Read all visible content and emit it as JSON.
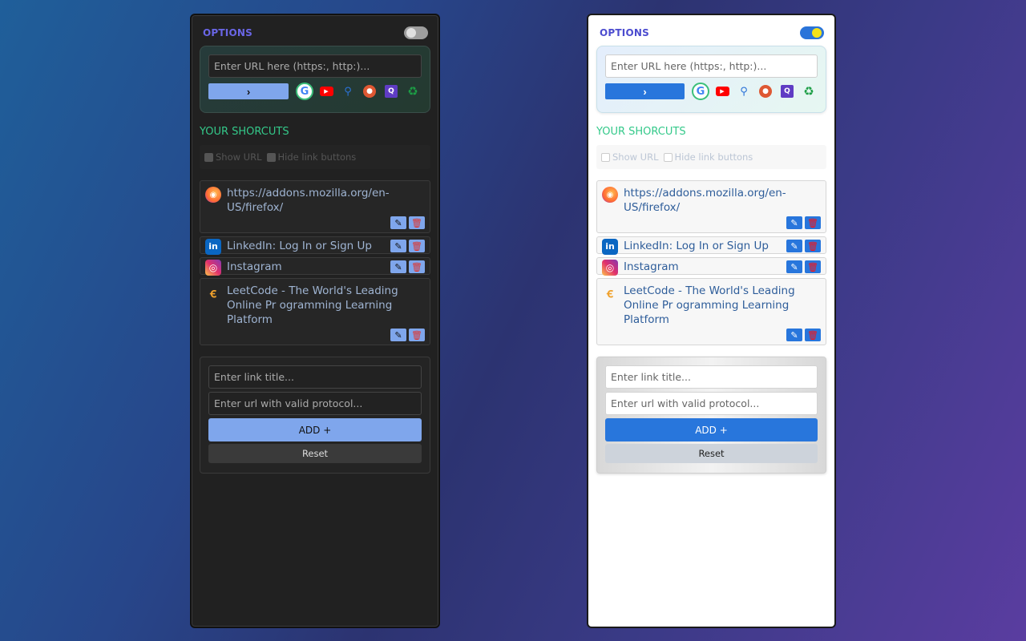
{
  "options_label": "OPTIONS",
  "search": {
    "placeholder": "Enter URL here (https:, http:)...",
    "go_label": "›",
    "engines": [
      "google-icon",
      "youtube-icon",
      "search-icon",
      "duckduckgo-icon",
      "yahoo-icon",
      "recycle-icon"
    ]
  },
  "shortcuts_title": "YOUR SHORCUTS",
  "filters": {
    "show_url": "Show URL",
    "hide_buttons": "Hide link buttons"
  },
  "links": [
    {
      "title": "https://addons.mozilla.org/en-US/firefox/",
      "icon": "firefox-icon"
    },
    {
      "title": "LinkedIn: Log In or Sign Up",
      "icon": "linkedin-icon"
    },
    {
      "title": "Instagram",
      "icon": "instagram-icon"
    },
    {
      "title": "LeetCode - The World's Leading Online Pr ogramming Learning Platform",
      "icon": "leetcode-icon"
    }
  ],
  "form": {
    "title_placeholder": "Enter link title...",
    "url_placeholder": "Enter url with valid protocol...",
    "add_label": "ADD +",
    "reset_label": "Reset"
  },
  "colors": {
    "accent_dark": "#7fa6ec",
    "accent_light": "#2876dc",
    "shortcuts_green": "#34c98a",
    "options_purple": "#6a66e6"
  }
}
